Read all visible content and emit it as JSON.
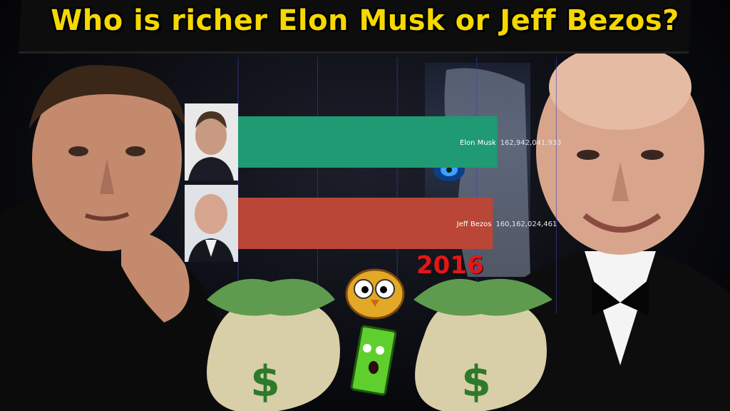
{
  "title": "Who is richer Elon Musk or Jeff Bezos?",
  "year_label": "2016",
  "colors": {
    "title": "#f4d800",
    "bar_musk": "#1f9a72",
    "bar_bezos": "#b94637",
    "year": "#e01818"
  },
  "chart_data": {
    "type": "bar",
    "orientation": "horizontal",
    "title": "",
    "categories": [
      "Elon Musk",
      "Jeff Bezos"
    ],
    "values": [
      162942041933,
      160162024461
    ],
    "value_labels": [
      "162,942,041,933",
      "160,162,024,461"
    ],
    "xlim": [
      0,
      220000000000
    ],
    "grid": true,
    "legend": "none"
  },
  "icons": [
    "elon-musk-photo",
    "jeff-bezos-photo",
    "money-bag-icon",
    "owl-mascot-icon",
    "dollar-bill-mascot-icon",
    "dollar-sign-icon"
  ]
}
